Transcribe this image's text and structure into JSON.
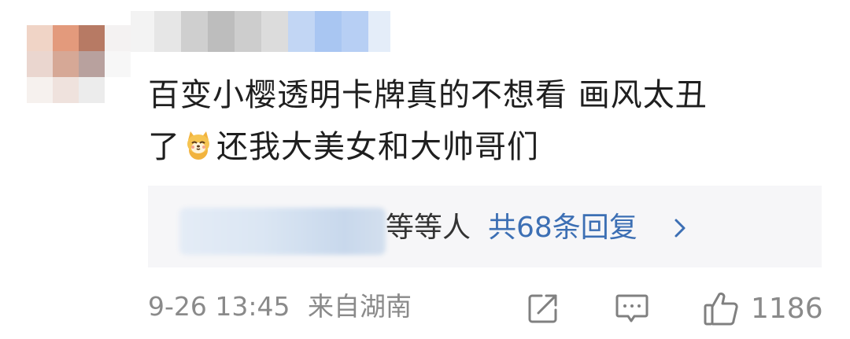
{
  "comment": {
    "text_line1": "百变小樱透明卡牌真的不想看 画风太丑",
    "text_line2_prefix": "了",
    "emoji": "shiba-dog-emoji",
    "text_line2_suffix": "还我大美女和大帅哥们",
    "timestamp": "9-26 13:45",
    "location": "来自湖南",
    "like_count": "1186"
  },
  "replies": {
    "names_suffix": "等等人",
    "total_label": "共68条回复",
    "chevron_icon": "chevron-right-icon"
  },
  "actions": {
    "share_icon": "share-icon",
    "reply_icon": "comment-icon",
    "like_icon": "thumbs-up-icon"
  },
  "colors": {
    "text": "#1f1f1f",
    "meta": "#8a8a8a",
    "link": "#3c6fb4",
    "reply_bg": "#f6f6f8"
  }
}
